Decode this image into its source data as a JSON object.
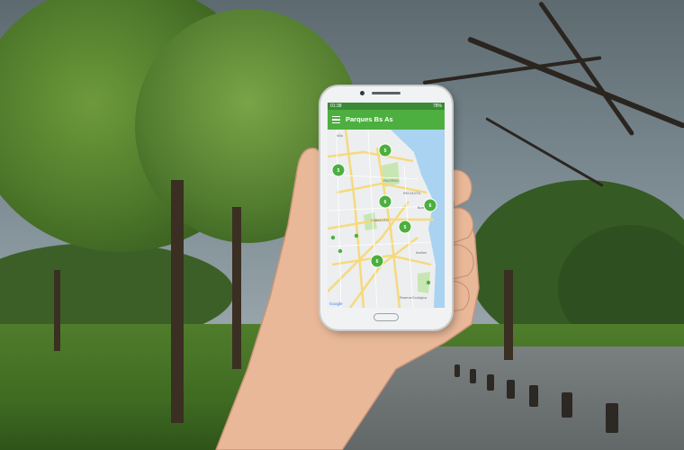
{
  "phone": {
    "status_time": "01:38",
    "status_battery": "78%",
    "app_title": "Parques Bs As",
    "menu_icon": "hamburger-menu-icon"
  },
  "map": {
    "labels": [
      "Villa",
      "PALERMO",
      "RECOLETA",
      "Bueno",
      "CABALLITO",
      "Avellan",
      "Reserva Ecológica",
      "Google"
    ],
    "clusters": [
      "5",
      "5",
      "6",
      "6",
      "5",
      "6"
    ],
    "colors": {
      "water": "#a9d3f0",
      "land": "#eceeef",
      "park": "#c8e6b3",
      "road": "#f6d97a",
      "cluster": "#4caf3f"
    }
  }
}
